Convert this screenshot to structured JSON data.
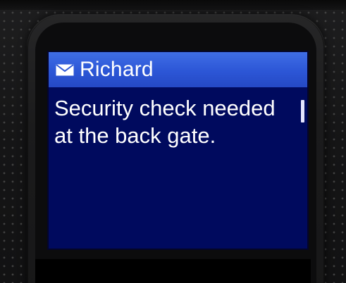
{
  "message": {
    "sender": "Richard",
    "body": "Security check needed at the back gate."
  },
  "icons": {
    "title_icon": "envelope-icon"
  },
  "colors": {
    "titlebar": "#2f5bdb",
    "screen_background": "#000a5e",
    "text": "#ffffff"
  }
}
